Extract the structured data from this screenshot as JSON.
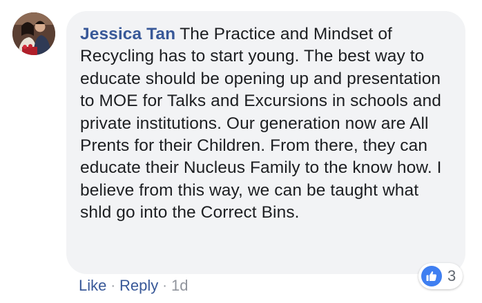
{
  "comment": {
    "author": "Jessica Tan",
    "text": "The Practice and Mindset of Recycling has to start young. The best way to educate should be opening up and presentation to MOE for Talks and Excursions in schools and private institutions. Our generation now are All Prents for their Children. From there, they can educate their Nucleus Family to the know how. I believe from this way, we can be taught what shld go into the Correct Bins.",
    "avatar_icon": "profile-photo"
  },
  "actions": {
    "like_label": "Like",
    "reply_label": "Reply",
    "separator": "·",
    "time": "1d"
  },
  "reactions": {
    "icon": "thumbs-up-icon",
    "count": "3",
    "color": "#3f7ff1"
  }
}
